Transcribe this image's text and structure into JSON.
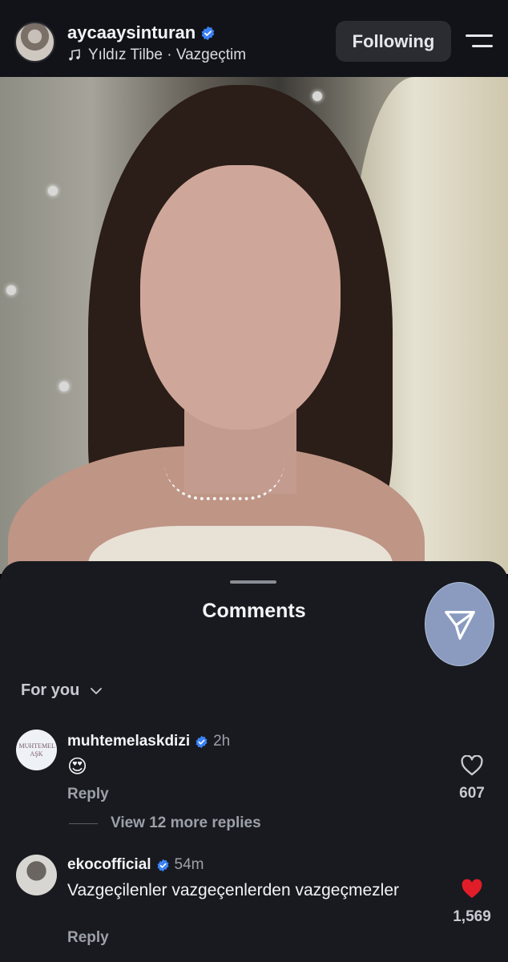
{
  "header": {
    "username": "aycaaysinturan",
    "music": "Yıldız Tilbe · Vazgeçtim",
    "following_label": "Following"
  },
  "icons": {
    "verified": "verified-badge-icon",
    "music": "music-note-icon",
    "menu": "menu-icon",
    "share": "send-icon",
    "heart": "heart-icon"
  },
  "colors": {
    "verified": "#3b82f6",
    "liked_heart": "#e11d2a"
  },
  "comments_panel": {
    "title": "Comments",
    "filter_label": "For you",
    "comments": [
      {
        "username": "muhtemelaskdizi",
        "time": "2h",
        "text": "😍",
        "reply_label": "Reply",
        "likes": "607",
        "liked": false,
        "avatar_text": "MUHTEMEL AŞK"
      },
      {
        "username": "ekocofficial",
        "time": "54m",
        "text": "Vazgeçilenler vazgeçenlerden vazgeçmezler",
        "reply_label": "Reply",
        "likes": "1,569",
        "liked": true
      }
    ],
    "more_replies_label": "View 12 more replies"
  }
}
